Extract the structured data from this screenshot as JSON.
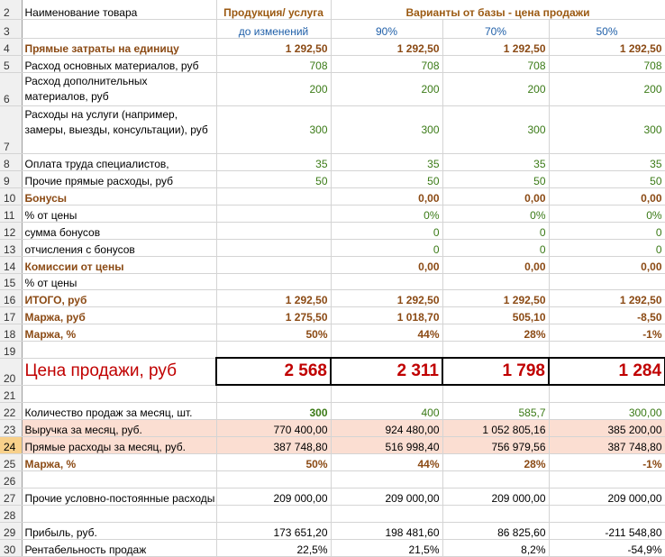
{
  "header": {
    "name_label": "Наименование товара",
    "product_label": "Продукция/ услуга",
    "variants_label": "Варианты от базы - цена продажи",
    "base_label": "до изменений",
    "v1": "90%",
    "v2": "70%",
    "v3": "50%"
  },
  "rows": {
    "r2": "2",
    "r3": "3",
    "r4": "4",
    "r5": "5",
    "r6": "6",
    "r7": "7",
    "r8": "8",
    "r9": "9",
    "r10": "10",
    "r11": "11",
    "r12": "12",
    "r13": "13",
    "r14": "14",
    "r15": "15",
    "r16": "16",
    "r17": "17",
    "r18": "18",
    "r19": "19",
    "r20": "20",
    "r21": "21",
    "r22": "22",
    "r23": "23",
    "r24": "24",
    "r25": "25",
    "r26": "26",
    "r27": "27",
    "r28": "28",
    "r29": "29",
    "r30": "30"
  },
  "direct_costs": {
    "label": "Прямые затраты на единицу",
    "base": "1 292,50",
    "v1": "1 292,50",
    "v2": "1 292,50",
    "v3": "1 292,50"
  },
  "main_materials": {
    "label": "Расход основных материалов, руб",
    "base": "708",
    "v1": "708",
    "v2": "708",
    "v3": "708"
  },
  "extra_materials": {
    "label": "Расход дополнительных материалов, руб",
    "base": "200",
    "v1": "200",
    "v2": "200",
    "v3": "200"
  },
  "services": {
    "label": "Расходы на услуги (например, замеры, выезды, консультации), руб",
    "base": "300",
    "v1": "300",
    "v2": "300",
    "v3": "300"
  },
  "labor": {
    "label": "Оплата труда специалистов,",
    "base": "35",
    "v1": "35",
    "v2": "35",
    "v3": "35"
  },
  "other_direct": {
    "label": "Прочие прямые расходы, руб",
    "base": "50",
    "v1": "50",
    "v2": "50",
    "v3": "50"
  },
  "bonuses": {
    "label": "Бонусы",
    "v1": "0,00",
    "v2": "0,00",
    "v3": "0,00"
  },
  "pct_price": {
    "label": "% от цены",
    "v1": "0%",
    "v2": "0%",
    "v3": "0%"
  },
  "bonus_sum": {
    "label": "сумма бонусов",
    "v1": "0",
    "v2": "0",
    "v3": "0"
  },
  "bonus_deductions": {
    "label": "отчисления с бонусов",
    "v1": "0",
    "v2": "0",
    "v3": "0"
  },
  "commissions": {
    "label": "Комиссии от цены",
    "v1": "0,00",
    "v2": "0,00",
    "v3": "0,00"
  },
  "pct_price2": {
    "label": "% от цены"
  },
  "total": {
    "label": "ИТОГО, руб",
    "base": "1 292,50",
    "v1": "1 292,50",
    "v2": "1 292,50",
    "v3": "1 292,50"
  },
  "margin_rub": {
    "label": "Маржа, руб",
    "base": "1 275,50",
    "v1": "1 018,70",
    "v2": "505,10",
    "v3": "-8,50"
  },
  "margin_pct": {
    "label": "Маржа, %",
    "base": "50%",
    "v1": "44%",
    "v2": "28%",
    "v3": "-1%"
  },
  "price": {
    "label": "Цена продажи, руб",
    "base": "2 568",
    "v1": "2 311",
    "v2": "1 798",
    "v3": "1 284"
  },
  "sales_qty": {
    "label": "Количество продаж за месяц, шт.",
    "base": "300",
    "v1": "400",
    "v2": "585,7",
    "v3": "300,00"
  },
  "revenue": {
    "label": "Выручка  за месяц, руб.",
    "base": "770 400,00",
    "v1": "924 480,00",
    "v2": "1 052 805,16",
    "v3": "385 200,00"
  },
  "direct_month": {
    "label": "Прямые расходы за месяц, руб.",
    "base": "387 748,80",
    "v1": "516 998,40",
    "v2": "756 979,56",
    "v3": "387 748,80"
  },
  "margin_pct2": {
    "label": "Маржа, %",
    "base": "50%",
    "v1": "44%",
    "v2": "28%",
    "v3": "-1%"
  },
  "fixed_costs": {
    "label": "Прочие условно-постоянные расходы",
    "base": "209 000,00",
    "v1": "209 000,00",
    "v2": "209 000,00",
    "v3": "209 000,00"
  },
  "profit": {
    "label": "Прибыль, руб.",
    "base": "173 651,20",
    "v1": "198 481,60",
    "v2": "86 825,60",
    "v3": "-211 548,80"
  },
  "profitability": {
    "label": "Рентабельность продаж",
    "base": "22,5%",
    "v1": "21,5%",
    "v2": "8,2%",
    "v3": "-54,9%"
  },
  "colors": {
    "header": "#9b5a13",
    "subheader": "#1f5fa8",
    "bold_brown": "#8b4a14",
    "green": "#3a7a16",
    "red": "#c00000",
    "highlight": "#fbded2",
    "selected_row_header": "#f8d08a"
  }
}
